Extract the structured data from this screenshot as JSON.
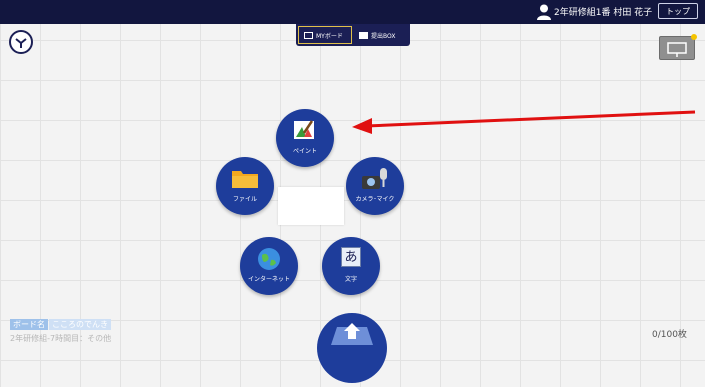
{
  "header": {
    "user_info": "2年研修組1番  村田  花子",
    "top_button": "トップ"
  },
  "tabs": [
    {
      "label": "MYボード",
      "icon": "board-icon"
    },
    {
      "label": "提出BOX",
      "icon": "inbox-icon"
    }
  ],
  "menu": {
    "paint": "ペイント",
    "file": "ファイル",
    "camera": "カメラ･マイク",
    "internet": "インターネット",
    "text": "文字",
    "text_glyph": "あ"
  },
  "footer": {
    "board_name_key": "ボード名",
    "board_name_value": "こころのでんき",
    "class_info": "2年研修組-7時間目：その他",
    "counter": "0/100枚"
  },
  "colors": {
    "header_bg": "#12163f",
    "button_blue": "#1e3d9b",
    "arrow_red": "#e01010"
  }
}
